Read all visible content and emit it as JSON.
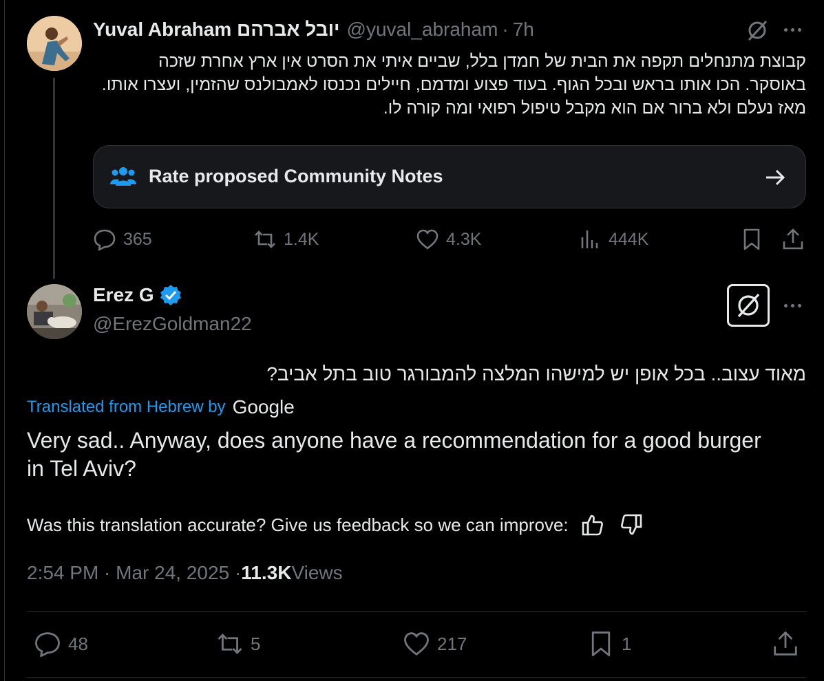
{
  "tweet1": {
    "display_name": "Yuval Abraham יובל אברהם",
    "handle": "@yuval_abraham",
    "separator": "·",
    "time": "7h",
    "text": "קבוצת מתנחלים תקפה את הבית של חמדן בלל, שביים איתי את הסרט אין ארץ אחרת שזכה באוסקר. הכו אותו בראש ובכל הגוף. בעוד פצוע ומדמם, חיילים נכנסו לאמבולנס שהזמין, ועצרו אותו. מאז נעלם ולא ברור אם הוא מקבל טיפול רפואי ומה קורה לו.",
    "community_notes_label": "Rate proposed Community Notes",
    "stats": {
      "replies": "365",
      "reposts": "1.4K",
      "likes": "4.3K",
      "views": "444K"
    }
  },
  "tweet2": {
    "display_name": "Erez G",
    "handle": "@ErezGoldman22",
    "text_original": "מאוד עצוב.. בכל אופן יש למישהו המלצה להמבורגר טוב בתל אביב?",
    "translated_label": "Translated from Hebrew by",
    "translator": "Google",
    "text_translated": "Very sad.. Anyway, does anyone have a recommendation for a good burger in Tel Aviv?",
    "feedback_prompt": "Was this translation accurate? Give us feedback so we can improve:",
    "timestamp": "2:54 PM · Mar 24, 2025 · ",
    "views_count": "11.3K",
    "views_label": " Views",
    "stats": {
      "replies": "48",
      "reposts": "5",
      "likes": "217",
      "bookmarks": "1"
    }
  },
  "colors": {
    "background": "#000000",
    "text_primary": "#e7e9ea",
    "text_secondary": "#71767b",
    "accent_blue": "#1d9bf0",
    "border": "#2f3336",
    "verified_badge": "#1d9bf0"
  }
}
